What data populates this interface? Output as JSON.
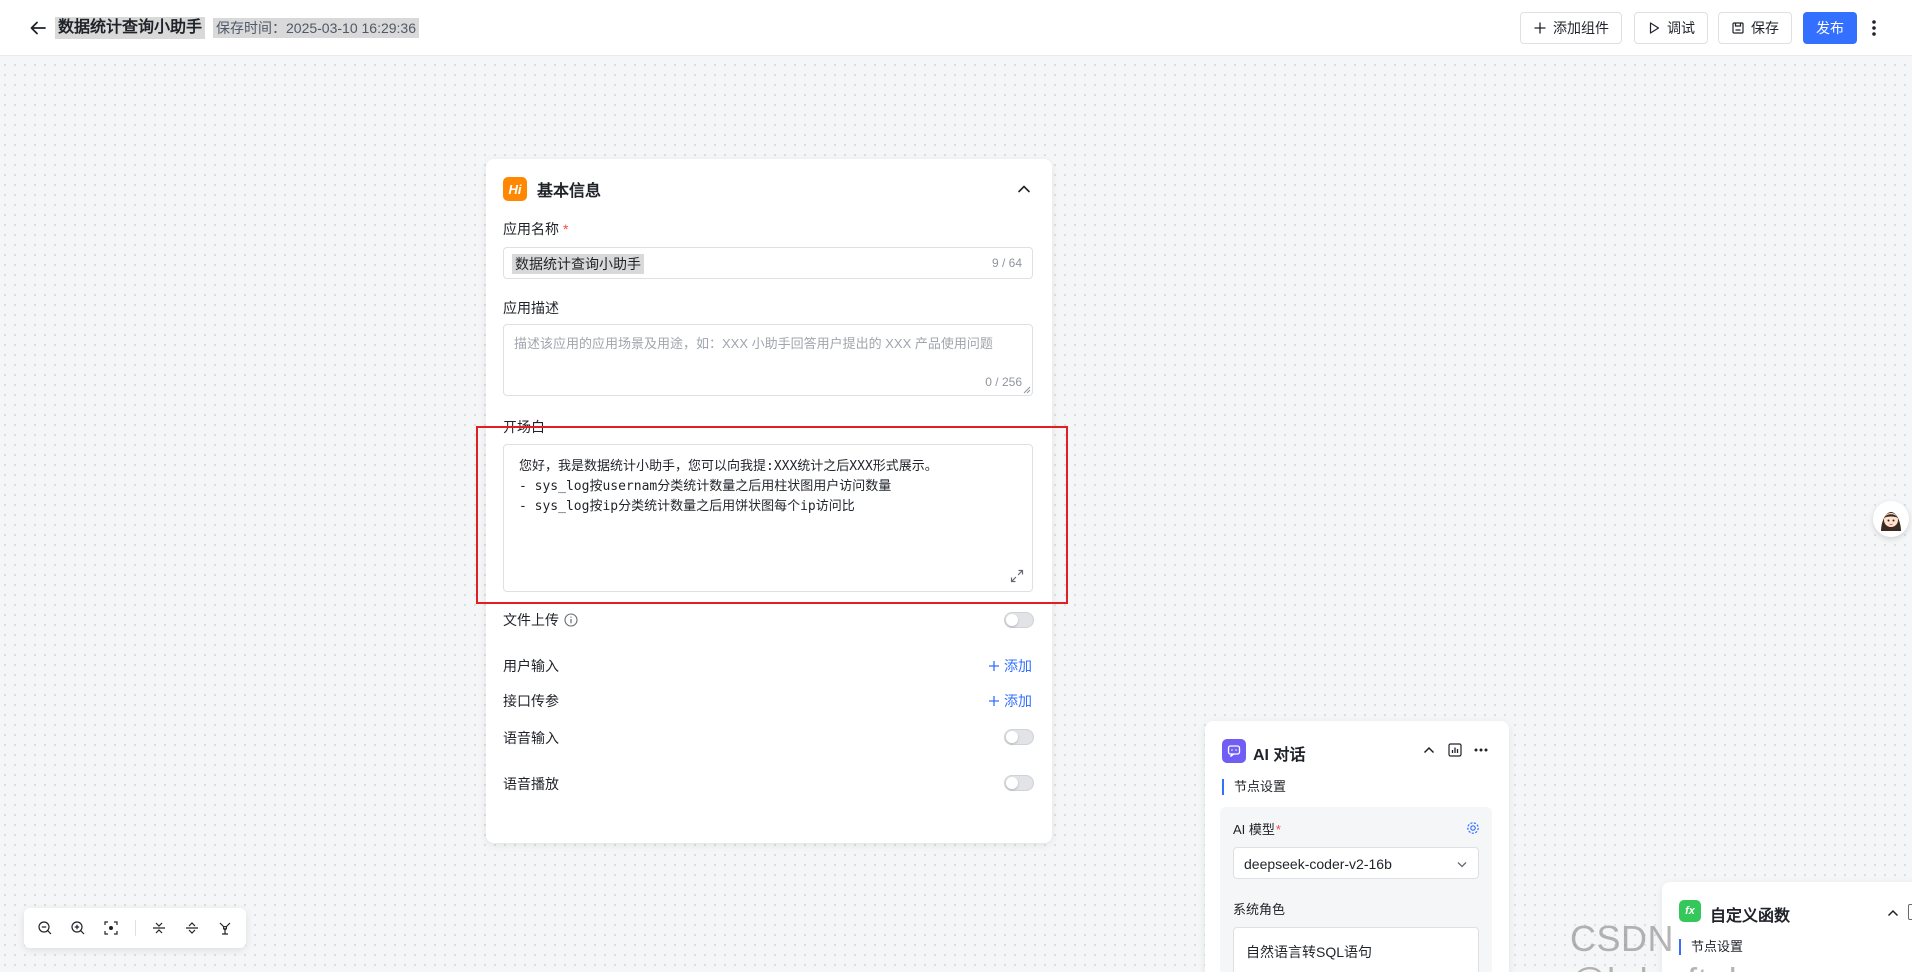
{
  "header": {
    "app_title": "数据统计查询小助手",
    "save_time": "保存时间：2025-03-10 16:29:36",
    "add_component": "添加组件",
    "debug": "调试",
    "save": "保存",
    "publish": "发布"
  },
  "basic_info": {
    "title": "基本信息",
    "icon_text": "Hi",
    "app_name_label": "应用名称",
    "required_mark": "*",
    "app_name_value": "数据统计查询小助手",
    "app_name_count": "9 / 64",
    "desc_label": "应用描述",
    "desc_placeholder": "描述该应用的应用场景及用途，如：XXX 小助手回答用户提出的 XXX 产品使用问题",
    "desc_count": "0 / 256",
    "prologue_label": "开场白",
    "prologue_text": "您好，我是数据统计小助手，您可以向我提:XXX统计之后XXX形式展示。\n- sys_log按usernam分类统计数量之后用柱状图用户访问数量\n- sys_log按ip分类统计数量之后用饼状图每个ip访问比",
    "file_upload_label": "文件上传",
    "user_input_label": "用户输入",
    "api_params_label": "接口传参",
    "add_label": "添加",
    "voice_input_label": "语音输入",
    "voice_play_label": "语音播放"
  },
  "ai_node": {
    "title": "AI 对话",
    "node_setting": "节点设置",
    "model_label": "AI 模型",
    "required_mark": "*",
    "model_value": "deepseek-coder-v2-16b",
    "system_role_label": "系统角色",
    "system_role_value": "自然语言转SQL语句"
  },
  "fn_node": {
    "title": "自定义函数",
    "icon_text": "fx",
    "node_setting": "节点设置"
  },
  "watermark": "CSDN @hdsoft_huge",
  "colors": {
    "primary": "#3370ff",
    "hi_icon": "#ff8800",
    "ai_icon": "#6f5df6",
    "fn_icon": "#34c759",
    "highlight": "#e02020"
  }
}
